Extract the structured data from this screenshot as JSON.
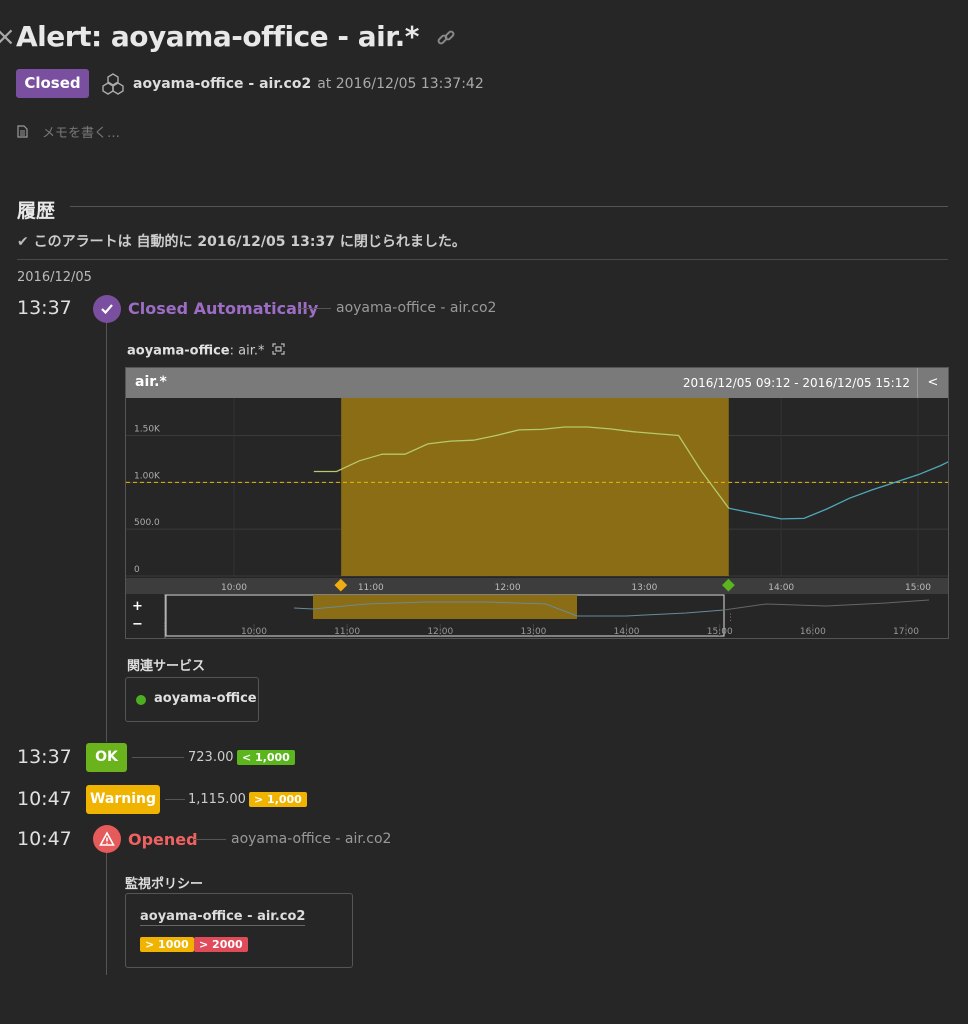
{
  "header": {
    "title": "Alert: aoyama-office - air.*",
    "status": "Closed",
    "host": "aoyama-office - air.co2",
    "timestamp": "at 2016/12/05 13:37:42",
    "memo_placeholder": "メモを書く…"
  },
  "history": {
    "heading": "履歴",
    "closed_message": "このアラートは 自動的に 2016/12/05 13:37 に閉じられました。",
    "date": "2016/12/05",
    "events": [
      {
        "time": "13:37",
        "label": "Closed Automatically",
        "source": "aoyama-office - air.co2"
      },
      {
        "time": "13:37",
        "label": "OK",
        "value": "723.00",
        "condition": "< 1,000"
      },
      {
        "time": "10:47",
        "label": "Warning",
        "value": "1,115.00",
        "condition": "> 1,000"
      },
      {
        "time": "10:47",
        "label": "Opened",
        "source": "aoyama-office - air.co2"
      }
    ]
  },
  "graph": {
    "label_host": "aoyama-office",
    "label_metric": ": air.*",
    "panel_title": "air.*",
    "range": "2016/12/05 09:12 - 2016/12/05 15:12",
    "zoom_in": "+",
    "zoom_out": "−",
    "nav_ticks": [
      "10:00",
      "11:00",
      "12:00",
      "13:00",
      "14:00",
      "15:00",
      "16:00",
      "17:00"
    ]
  },
  "chart_data": {
    "type": "line",
    "x_ticks": [
      "10:00",
      "11:00",
      "12:00",
      "13:00",
      "14:00",
      "15:00"
    ],
    "y_ticks": [
      "0",
      "500.0",
      "1.00K",
      "1.50K"
    ],
    "ylim": [
      0,
      1900
    ],
    "threshold": 1000,
    "alert_window": [
      "10:47",
      "13:37"
    ],
    "series": [
      {
        "x": [
          "10:35",
          "10:45",
          "10:55",
          "11:05",
          "11:15",
          "11:25",
          "11:35",
          "11:45",
          "11:55",
          "12:05",
          "12:15",
          "12:25",
          "12:35",
          "12:45",
          "12:55",
          "13:05",
          "13:15",
          "13:25",
          "13:37",
          "13:50",
          "14:00",
          "14:10",
          "14:20",
          "14:30",
          "14:40",
          "14:50",
          "15:00",
          "15:10",
          "15:20"
        ],
        "values": [
          1115,
          1115,
          1230,
          1300,
          1300,
          1410,
          1440,
          1450,
          1500,
          1560,
          1565,
          1590,
          1590,
          1570,
          1540,
          1520,
          1500,
          1120,
          723,
          660,
          610,
          615,
          715,
          830,
          920,
          1000,
          1080,
          1180,
          1300
        ],
        "color_alert": "#b8c96b",
        "color_normal": "#4fa8b8"
      }
    ],
    "colors": {
      "window": "#8a6d14",
      "threshold": "#e6b800",
      "warning": "#f0ad10",
      "ok": "#5bb51c"
    }
  },
  "related": {
    "heading": "関連サービス",
    "service": "aoyama-office"
  },
  "policy": {
    "heading": "監視ポリシー",
    "name": "aoyama-office - air.co2",
    "warning": "> 1000",
    "critical": "> 2000"
  },
  "colors": {
    "closed": "#7b4fa0",
    "ok": "#6ab31d",
    "warning": "#f0b400",
    "critical": "#e04b4b"
  }
}
